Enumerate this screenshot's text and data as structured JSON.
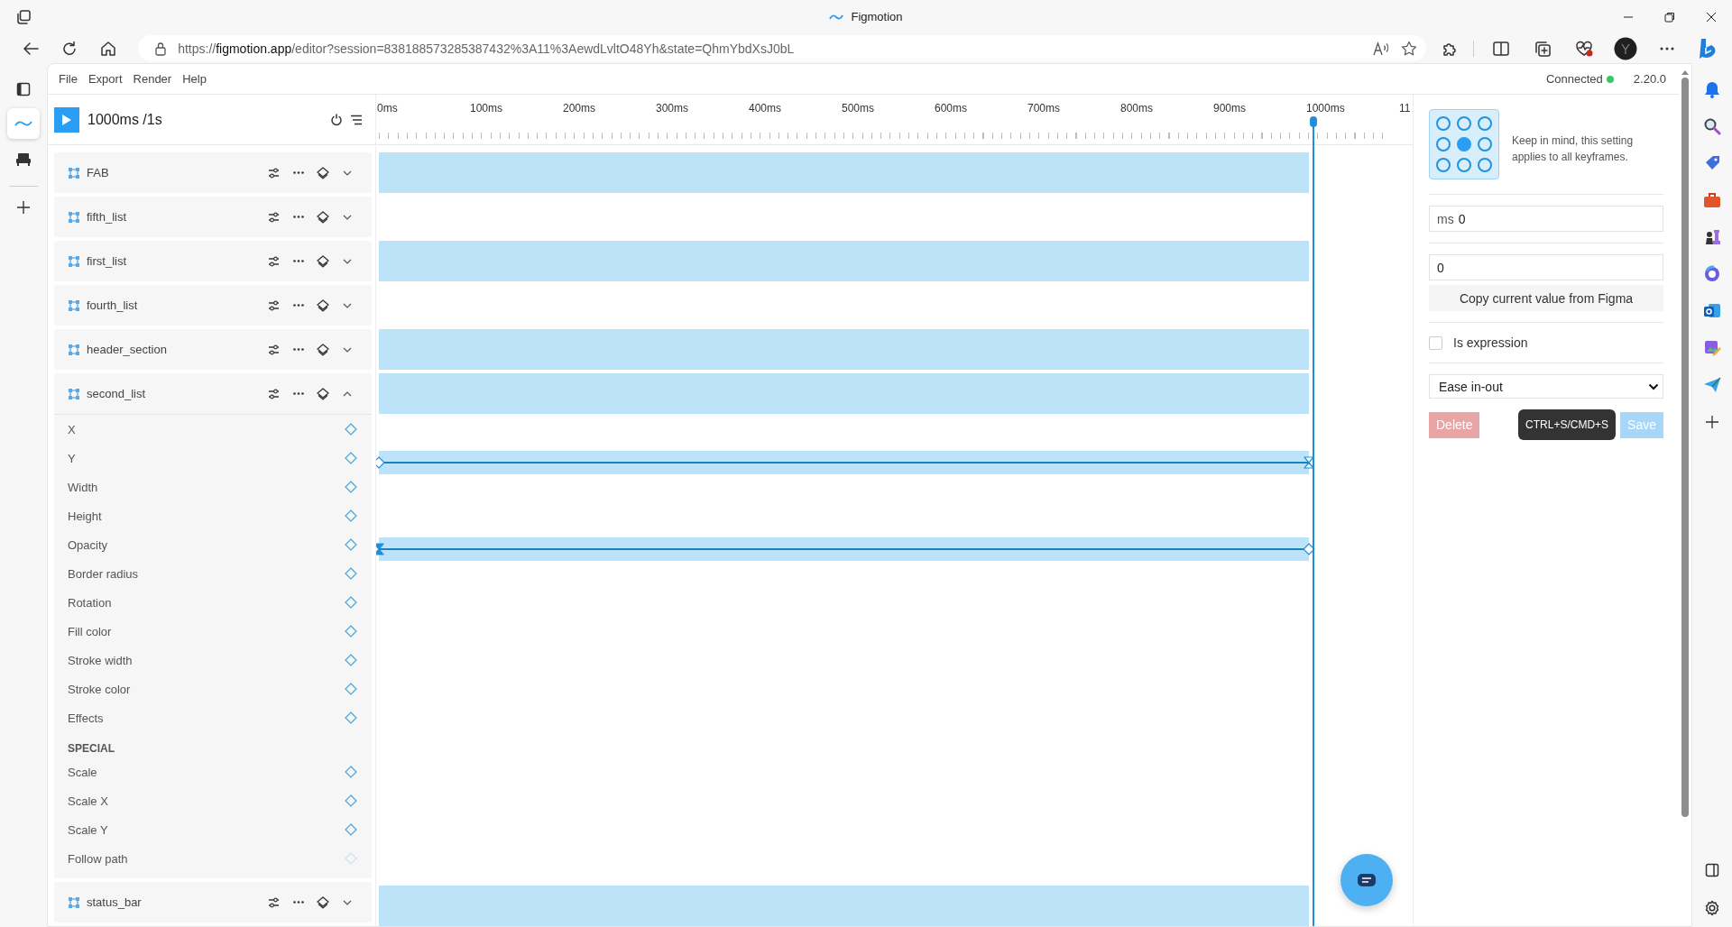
{
  "browser": {
    "tab_title": "Figmotion",
    "url": {
      "scheme": "https://",
      "host": "figmotion.app",
      "path": "/editor?session=838188573285387432%3A11%3AewdLvltO48Yh&state=QhmYbdXsJ0bL"
    },
    "side_apps": [
      {
        "selected": true
      },
      {
        "selected": false
      }
    ]
  },
  "menu": [
    "File",
    "Export",
    "Render",
    "Help"
  ],
  "status": {
    "text": "Connected",
    "connected": true,
    "version": "2.20.0"
  },
  "timeline": {
    "time": "1000ms /1s",
    "ticks": [
      "0ms",
      "100ms",
      "200ms",
      "300ms",
      "400ms",
      "500ms",
      "600ms",
      "700ms",
      "800ms",
      "900ms",
      "1000ms",
      "11"
    ]
  },
  "layers": [
    {
      "name": "FAB",
      "animated": true,
      "expanded": false
    },
    {
      "name": "fifth_list",
      "animated": false,
      "expanded": false
    },
    {
      "name": "first_list",
      "animated": true,
      "expanded": false
    },
    {
      "name": "fourth_list",
      "animated": false,
      "expanded": false
    },
    {
      "name": "header_section",
      "animated": true,
      "expanded": false
    },
    {
      "name": "second_list",
      "animated": true,
      "expanded": true,
      "properties": [
        {
          "kind": "property",
          "name": "X",
          "disabled": false
        },
        {
          "kind": "property",
          "name": "Y",
          "disabled": false,
          "keyframes": [
            {
              "kind": "diamond",
              "selected": false
            },
            {
              "kind": "hourglass",
              "selected": false
            }
          ]
        },
        {
          "kind": "property",
          "name": "Width",
          "disabled": false
        },
        {
          "kind": "property",
          "name": "Height",
          "disabled": false
        },
        {
          "kind": "property",
          "name": "Opacity",
          "disabled": false,
          "keyframes": [
            {
              "kind": "hourglass",
              "selected": true
            },
            {
              "kind": "diamond",
              "selected": false
            }
          ]
        },
        {
          "kind": "property",
          "name": "Border radius",
          "disabled": false
        },
        {
          "kind": "property",
          "name": "Rotation",
          "disabled": false
        },
        {
          "kind": "property",
          "name": "Fill color",
          "disabled": false
        },
        {
          "kind": "property",
          "name": "Stroke width",
          "disabled": false
        },
        {
          "kind": "property",
          "name": "Stroke color",
          "disabled": false
        },
        {
          "kind": "property",
          "name": "Effects",
          "disabled": false
        },
        {
          "kind": "heading",
          "name": "SPECIAL"
        },
        {
          "kind": "property",
          "name": "Scale",
          "disabled": false
        },
        {
          "kind": "property",
          "name": "Scale X",
          "disabled": false
        },
        {
          "kind": "property",
          "name": "Scale Y",
          "disabled": false
        },
        {
          "kind": "property",
          "name": "Follow path",
          "disabled": true
        }
      ]
    },
    {
      "name": "status_bar",
      "animated": true,
      "expanded": false
    }
  ],
  "inspector": {
    "anchor": [
      {
        "selected": false
      },
      {
        "selected": false
      },
      {
        "selected": false
      },
      {
        "selected": false
      },
      {
        "selected": true
      },
      {
        "selected": false
      },
      {
        "selected": false
      },
      {
        "selected": false
      },
      {
        "selected": false
      }
    ],
    "note": "Keep in mind, this setting applies to all keyframes.",
    "ms_field": {
      "unit": "ms",
      "value": "0"
    },
    "value_field": {
      "value": "0"
    },
    "copy_button": "Copy current value from Figma",
    "is_expression": {
      "label": "Is expression",
      "checked": false
    },
    "easing": {
      "value": "Ease in-out"
    },
    "delete_button": {
      "label": "Delete",
      "disabled": true
    },
    "shortcut_tooltip": "CTRL+S/CMD+S",
    "save_button": {
      "label": "Save",
      "disabled": true
    }
  }
}
